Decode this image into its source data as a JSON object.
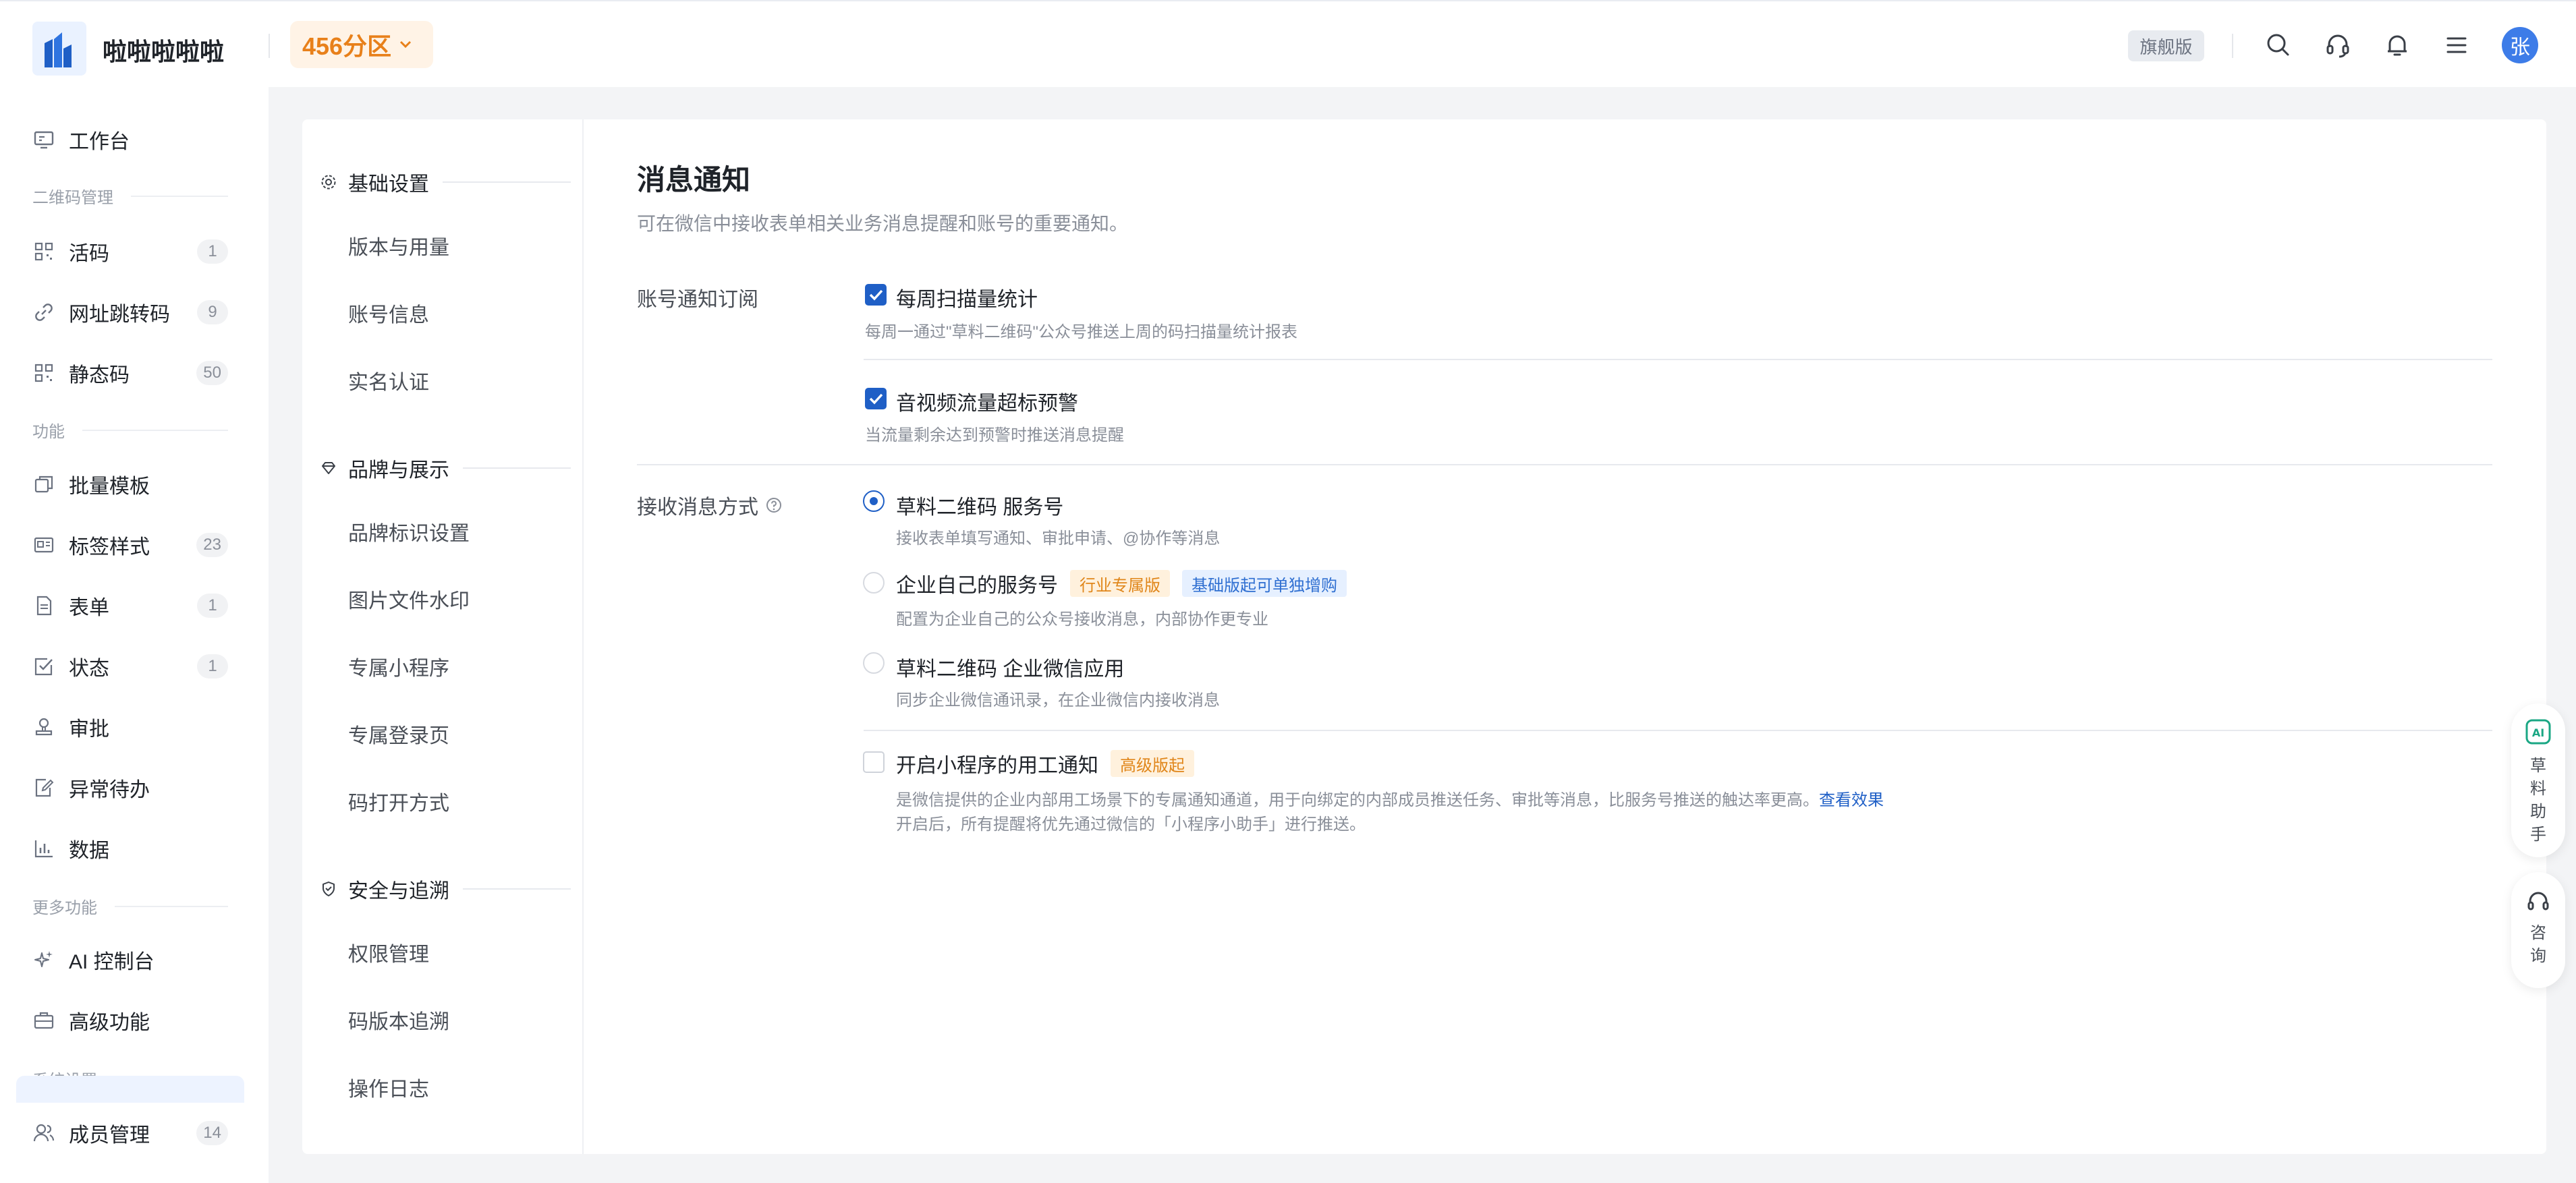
{
  "header": {
    "app_title": "啦啦啦啦啦",
    "partition": "456分区",
    "edition": "旗舰版",
    "avatar_text": "张",
    "icons": [
      "search-icon",
      "headset-icon",
      "bell-icon",
      "menu-icon"
    ]
  },
  "sidebar": {
    "workbench": "工作台",
    "sections": {
      "qr": "二维码管理",
      "features": "功能",
      "more": "更多功能",
      "system": "系统设置"
    },
    "items": {
      "live_code": {
        "label": "活码",
        "count": "1"
      },
      "url_redirect": {
        "label": "网址跳转码",
        "count": "9"
      },
      "static_code": {
        "label": "静态码",
        "count": "50"
      },
      "batch_template": {
        "label": "批量模板"
      },
      "label_style": {
        "label": "标签样式",
        "count": "23"
      },
      "form": {
        "label": "表单",
        "count": "1"
      },
      "status": {
        "label": "状态",
        "count": "1"
      },
      "approval": {
        "label": "审批"
      },
      "exception_todo": {
        "label": "异常待办"
      },
      "data": {
        "label": "数据"
      },
      "ai_console": {
        "label": "AI 控制台"
      },
      "advanced": {
        "label": "高级功能"
      },
      "members": {
        "label": "成员管理",
        "count": "14"
      }
    }
  },
  "subnav": {
    "basic": {
      "title": "基础设置",
      "items": [
        "版本与用量",
        "账号信息",
        "实名认证"
      ]
    },
    "brand": {
      "title": "品牌与展示",
      "items": [
        "品牌标识设置",
        "图片文件水印",
        "专属小程序",
        "专属登录页",
        "码打开方式"
      ]
    },
    "security": {
      "title": "安全与追溯",
      "items": [
        "权限管理",
        "码版本追溯",
        "操作日志"
      ]
    }
  },
  "content": {
    "title": "消息通知",
    "description": "可在微信中接收表单相关业务消息提醒和账号的重要通知。",
    "subscription": {
      "label": "账号通知订阅",
      "options": [
        {
          "title": "每周扫描量统计",
          "desc": "每周一通过\"草料二维码\"公众号推送上周的码扫描量统计报表",
          "checked": true
        },
        {
          "title": "音视频流量超标预警",
          "desc": "当流量剩余达到预警时推送消息提醒",
          "checked": true
        }
      ]
    },
    "receive": {
      "label": "接收消息方式",
      "options": [
        {
          "title": "草料二维码 服务号",
          "desc": "接收表单填写通知、审批申请、@协作等消息",
          "selected": true
        },
        {
          "title": "企业自己的服务号",
          "tag1": "行业专属版",
          "tag2": "基础版起可单独增购",
          "desc": "配置为企业自己的公众号接收消息，内部协作更专业",
          "selected": false
        },
        {
          "title": "草料二维码 企业微信应用",
          "desc": "同步企业微信通讯录，在企业微信内接收消息",
          "selected": false
        }
      ],
      "mini_program": {
        "title": "开启小程序的用工通知",
        "tag": "高级版起",
        "desc1": "是微信提供的企业内部用工场景下的专属通知通道，用于向绑定的内部成员推送任务、审批等消息，比服务号推送的触达率更高。",
        "link": "查看效果",
        "desc2": "开启后，所有提醒将优先通过微信的「小程序小助手」进行推送。",
        "checked": false
      }
    }
  },
  "floating": {
    "assistant": "草料助手",
    "consult": "咨询"
  },
  "colors": {
    "primary": "#1f5fc6",
    "accent_orange": "#e8801a",
    "avatar": "#3d7ce8"
  }
}
